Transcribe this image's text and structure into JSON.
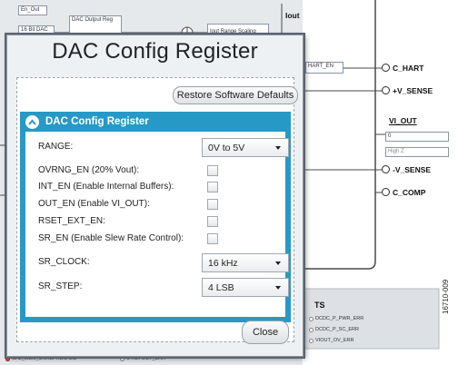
{
  "dialog": {
    "title": "DAC Config Register",
    "restore_label": "Restore Software Defaults",
    "close_label": "Close",
    "panel": {
      "title": "DAC Config Register",
      "fields": [
        {
          "label": "RANGE:",
          "type": "select",
          "value": "0V to 5V"
        },
        {
          "label": "OVRNG_EN (20% Vout):",
          "type": "checkbox",
          "checked": false
        },
        {
          "label": "INT_EN (Enable Internal Buffers):",
          "type": "checkbox",
          "checked": false
        },
        {
          "label": "OUT_EN (Enable VI_OUT):",
          "type": "checkbox",
          "checked": false
        },
        {
          "label": "RSET_EXT_EN:",
          "type": "checkbox",
          "checked": false
        },
        {
          "label": "SR_EN (Enable Slew Rate Control):",
          "type": "checkbox",
          "checked": false
        },
        {
          "label": "SR_CLOCK:",
          "type": "select",
          "value": "16 kHz"
        },
        {
          "label": "SR_STEP:",
          "type": "select",
          "value": "4 LSB"
        }
      ]
    }
  },
  "background": {
    "en_out": "En_Out",
    "dac_16bit": "16 Bit DAC",
    "dac_output_reg": "DAC Output Reg",
    "iout_range_scaling": "Iout Range Scaling",
    "iout": "Iout",
    "hart_en": "HART_EN",
    "signals": [
      "C_HART",
      "+V_SENSE",
      "VI_OUT",
      "-V_SENSE",
      "C_COMP"
    ],
    "vi_out_value": "0",
    "vi_out_mode": "High Z",
    "status_heading": "TS",
    "status_items": [
      "DCDC_P_PWR_ERR",
      "DCDC_P_SC_ERR",
      "VIOUT_OV_ERR"
    ],
    "bottom_items": [
      "CAL_MEM_UNREFRESHED",
      "O REFOUT_ERR"
    ]
  },
  "watermark": "16710-009"
}
